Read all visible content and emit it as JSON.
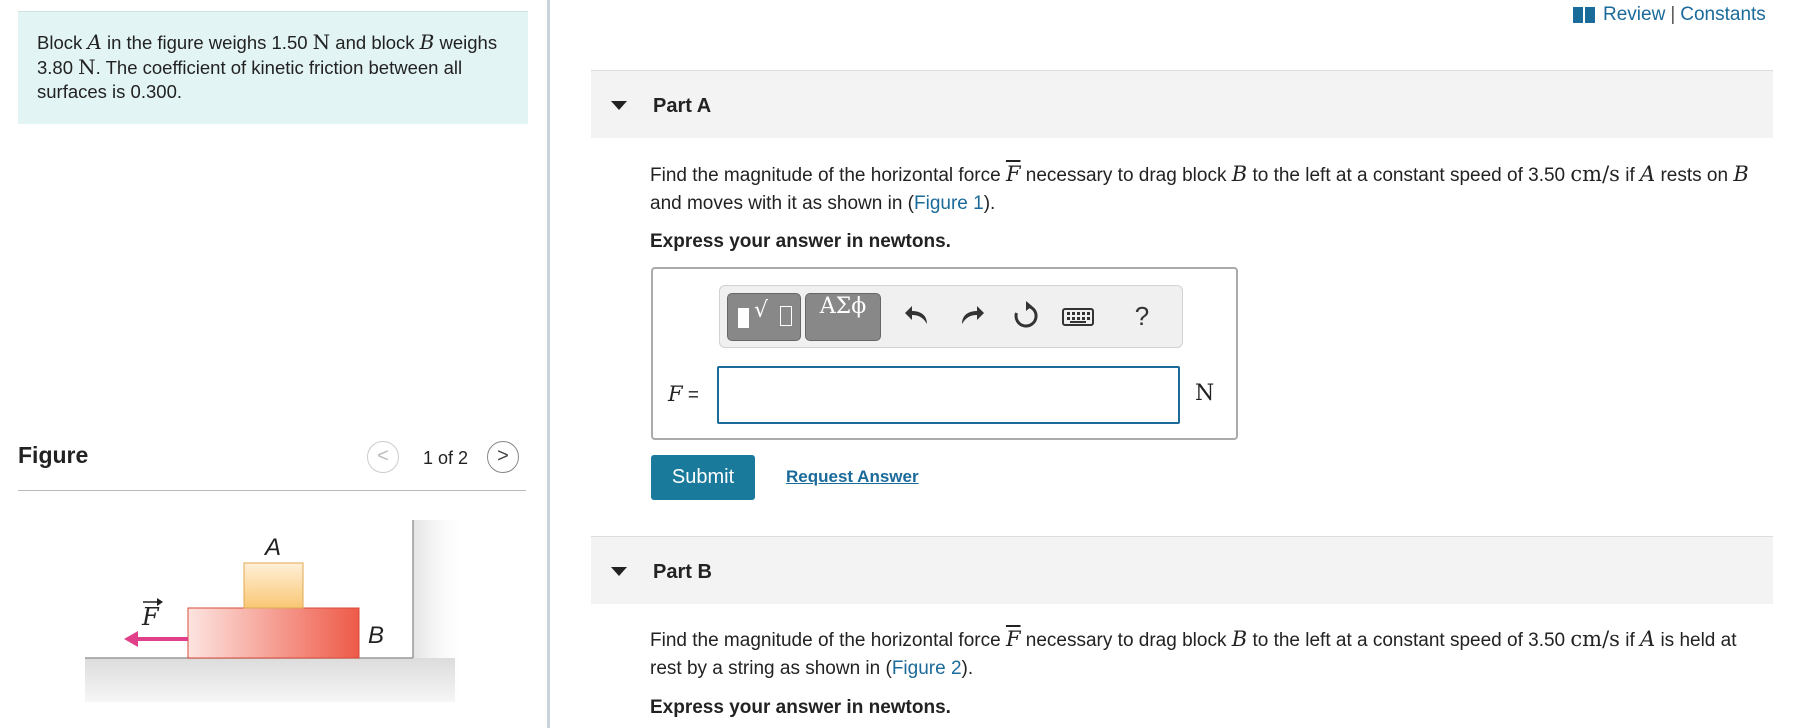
{
  "problem": {
    "t1": "Block ",
    "blockA": "A",
    "t2": " in the figure weighs 1.50 ",
    "unitN1": "N",
    "t3": " and block ",
    "blockB": "B",
    "t4": " weighs 3.80 ",
    "unitN2": "N",
    "t5": ". The coefficient of kinetic friction between all surfaces is 0.300."
  },
  "figure": {
    "title": "Figure",
    "counter": "1 of 2",
    "prev_symbol": "<",
    "next_symbol": ">",
    "label_a": "A",
    "label_b": "B",
    "force_label": "F",
    "colors": {
      "force_arrow": "#e0408a",
      "block_a": "#f9c774",
      "block_b": "#ee5a48"
    }
  },
  "header": {
    "review": "Review",
    "sep": "|",
    "constants": "Constants"
  },
  "partA": {
    "label": "Part A",
    "q1": "Find the magnitude of the horizontal force ",
    "force": "F",
    "q2": " necessary to drag block ",
    "blockB": "B",
    "q3": " to the left at a constant speed of 3.50 ",
    "unit": "cm/s",
    "q4": " if ",
    "blockA": "A",
    "q5": " rests on ",
    "blockB2": "B",
    "q6": " and moves with it as shown in (",
    "fig": "Figure 1",
    "q7": ").",
    "express": "Express your answer in newtons.",
    "input_label": "F",
    "equals": " =",
    "unit_answer": "N",
    "input_value": "",
    "toolbar": {
      "greek": "ΑΣϕ",
      "help": "?"
    },
    "submit": "Submit",
    "request": "Request Answer"
  },
  "partB": {
    "label": "Part B",
    "q1": "Find the magnitude of the horizontal force ",
    "force": "F",
    "q2": " necessary to drag block ",
    "blockB": "B",
    "q3": " to the left at a constant speed of 3.50 ",
    "unit": "cm/s",
    "q4": " if ",
    "blockA": "A",
    "q5": " is held at rest by a string as shown in (",
    "fig": "Figure 2",
    "q6": ").",
    "express": "Express your answer in newtons."
  },
  "accent_color": "#1a7a9c"
}
